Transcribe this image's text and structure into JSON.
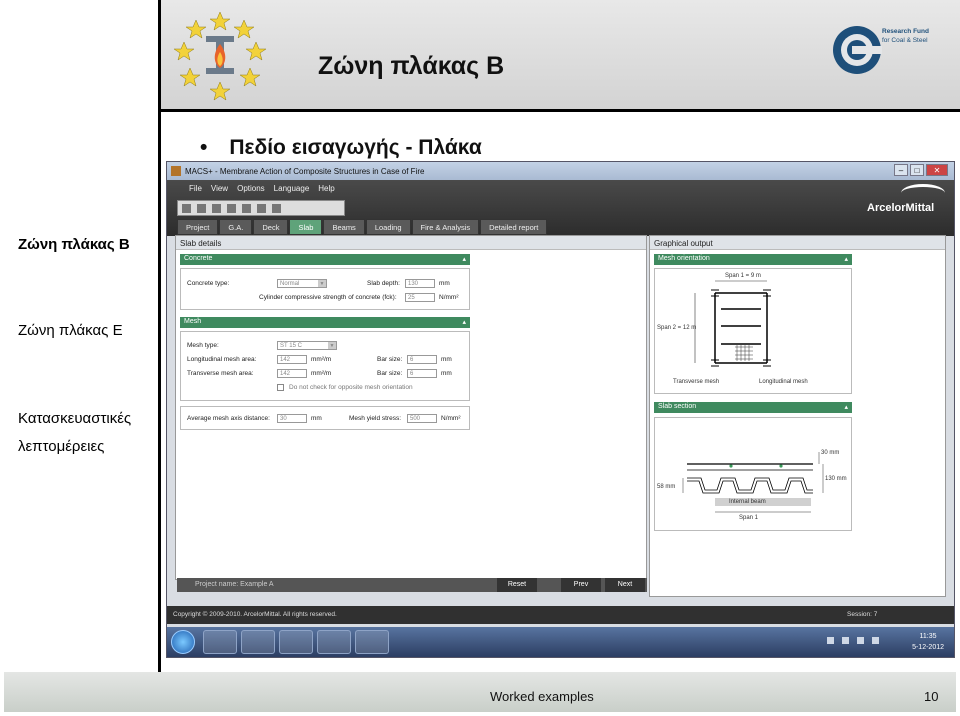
{
  "slide": {
    "title": "Ζώνη πλάκας B",
    "bullet": "Πεδίο εισαγωγής - Πλάκα",
    "bullet_marker": "•",
    "side_links": [
      "Ζώνη πλάκας B",
      "Ζώνη πλάκας E",
      "Κατασκευαστικές",
      "λεπτομέρειες"
    ],
    "footer_center": "Worked examples",
    "footer_page": "10",
    "logo_right_line1": "Research Fund",
    "logo_right_line2": "for Coal & Steel"
  },
  "app": {
    "window_title": "MACS+ - Membrane Action of Composite Structures in Case of Fire",
    "menu": [
      "File",
      "View",
      "Options",
      "Language",
      "Help"
    ],
    "brand": "ArcelorMittal",
    "tabs": [
      "Project",
      "G.A.",
      "Deck",
      "Slab",
      "Beams",
      "Loading",
      "Fire & Analysis",
      "Detailed report"
    ],
    "active_tab": "Slab",
    "slab_details": {
      "panel_title": "Slab details",
      "concrete": {
        "section": "Concrete",
        "concrete_type_label": "Concrete type:",
        "concrete_type_value": "Normal",
        "slab_depth_label": "Slab depth:",
        "slab_depth_value": "130",
        "slab_depth_unit": "mm",
        "cyl_label": "Cylinder compressive strength of concrete (fck):",
        "cyl_value": "25",
        "cyl_unit": "N/mm²"
      },
      "mesh": {
        "section": "Mesh",
        "mesh_type_label": "Mesh type:",
        "mesh_type_value": "ST 15 C",
        "long_label": "Longitudinal mesh area:",
        "long_value": "142",
        "long_unit": "mm²/m",
        "bar_size_label": "Bar size:",
        "bar_size_long": "6",
        "bar_size_unit": "mm",
        "trans_label": "Transverse mesh area:",
        "trans_value": "142",
        "trans_unit": "mm²/m",
        "bar_size_trans": "6",
        "checkbox_label": "Do not check for opposite mesh orientation"
      },
      "axis": {
        "avg_label": "Average mesh axis distance:",
        "avg_value": "30",
        "avg_unit": "mm",
        "yield_label": "Mesh yield stress:",
        "yield_value": "500",
        "yield_unit": "N/mm²"
      }
    },
    "graphical_output": {
      "panel_title": "Graphical output",
      "mesh_orientation": "Mesh orientation",
      "span1": "Span 1 = 9 m",
      "span2": "Span 2 = 12 m",
      "transverse_mesh": "Transverse mesh",
      "longitudinal_mesh": "Longitudinal mesh",
      "slab_section": "Slab section",
      "dim_30": "30 mm",
      "dim_130": "130 mm",
      "dim_58": "58 mm",
      "internal_beam": "Internal beam",
      "span_label": "Span 1"
    },
    "bottom": {
      "project_name": "Project name: Example A",
      "reset": "Reset",
      "prev": "Prev",
      "next": "Next"
    },
    "status": {
      "copyright": "Copyright © 2009-2010. ArcelorMittal. All rights reserved.",
      "session": "Session: 7"
    },
    "taskbar": {
      "time": "11:35",
      "date": "5-12-2012"
    }
  }
}
